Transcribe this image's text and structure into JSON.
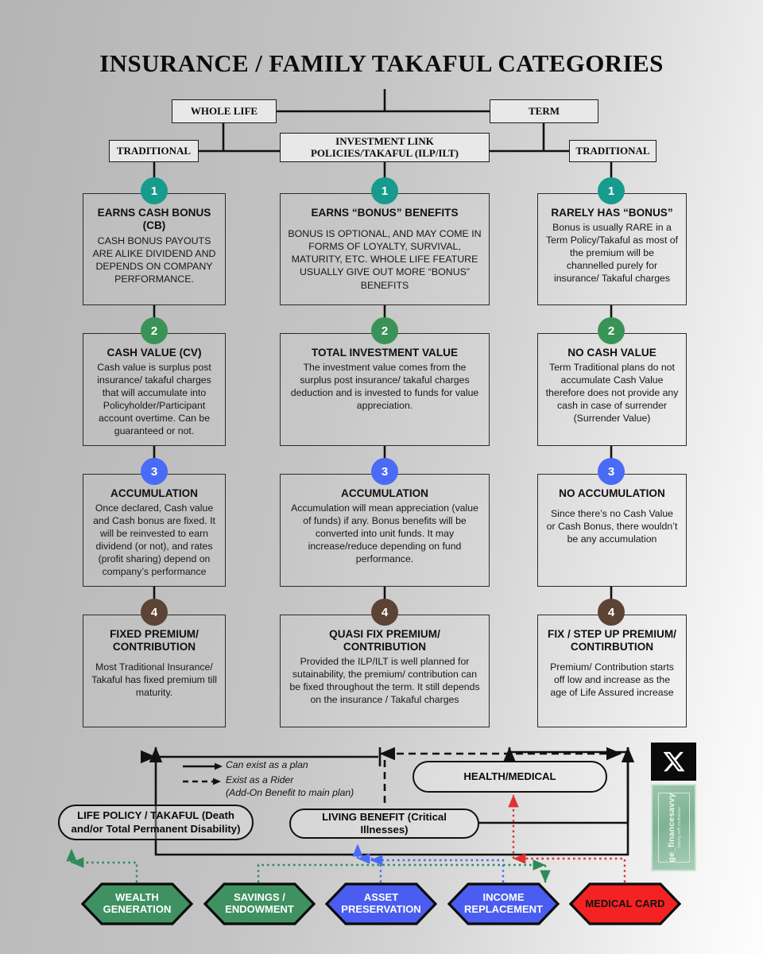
{
  "title": "INSURANCE  /  FAMILY TAKAFUL CATEGORIES",
  "top_nodes": {
    "whole_life": "WHOLE LIFE",
    "term": "TERM",
    "traditional_left": "TRADITIONAL",
    "traditional_right": "TRADITIONAL",
    "ilp": "INVESTMENT LINK\nPOLICIES/TAKAFUL (ILP/ILT)"
  },
  "columns": [
    {
      "key": "whole-life-traditional",
      "cards": [
        {
          "num": "1",
          "color": "#169b8c",
          "heading": "EARNS CASH BONUS (CB)",
          "body": "CASH BONUS PAYOUTS ARE ALIKE DIVIDEND AND DEPENDS ON COMPANY PERFORMANCE.",
          "spaced": false
        },
        {
          "num": "2",
          "color": "#3a9356",
          "heading": "CASH VALUE (CV)",
          "body": "Cash value is surplus post insurance/ takaful charges that will accumulate into Policyholder/Participant account overtime. Can be guaranteed or not.",
          "spaced": false
        },
        {
          "num": "3",
          "color": "#4a6bf5",
          "heading": "ACCUMULATION",
          "body": "Once declared, Cash value and Cash bonus are fixed. It will be reinvested to earn dividend (or not), and rates (profit sharing) depend on company’s performance",
          "spaced": false
        },
        {
          "num": "4",
          "color": "#5d4335",
          "heading": "FIXED PREMIUM/ CONTRIBUTION",
          "body": "Most Traditional Insurance/ Takaful has fixed premium till maturity.",
          "spaced": true
        }
      ]
    },
    {
      "key": "investment-link",
      "cards": [
        {
          "num": "1",
          "color": "#169b8c",
          "heading": "EARNS “BONUS” BENEFITS",
          "body": "BONUS IS OPTIONAL, AND MAY COME IN FORMS OF LOYALTY, SURVIVAL, MATURITY, ETC. WHOLE LIFE FEATURE USUALLY GIVE OUT MORE “BONUS” BENEFITS",
          "spaced": true
        },
        {
          "num": "2",
          "color": "#3a9356",
          "heading": "TOTAL INVESTMENT VALUE",
          "body": "The investment value comes from the surplus post insurance/ takaful charges deduction and is invested to funds for value appreciation.",
          "spaced": false
        },
        {
          "num": "3",
          "color": "#4a6bf5",
          "heading": "ACCUMULATION",
          "body": "Accumulation will mean appreciation (value of funds) if any. Bonus benefits will be converted into unit funds. It may increase/reduce depending on fund performance.",
          "spaced": false
        },
        {
          "num": "4",
          "color": "#5d4335",
          "heading": "QUASI FIX PREMIUM/ CONTRIBUTION",
          "body": "Provided the ILP/ILT is well planned for sutainability, the premium/ contribution can be fixed throughout the term. It still depends on the insurance / Takaful charges",
          "spaced": false
        }
      ]
    },
    {
      "key": "term-traditional",
      "cards": [
        {
          "num": "1",
          "color": "#169b8c",
          "heading": "RARELY HAS “BONUS”",
          "body": "Bonus is usually RARE in a Term Policy/Takaful as most of the premium will be channelled purely for insurance/ Takaful charges",
          "spaced": false
        },
        {
          "num": "2",
          "color": "#3a9356",
          "heading": "NO CASH VALUE",
          "body": "Term Traditional plans do not accumulate Cash Value therefore does not provide any cash in case of surrender (Surrender Value)",
          "spaced": false
        },
        {
          "num": "3",
          "color": "#4a6bf5",
          "heading": "NO ACCUMULATION",
          "body": "Since there’s no Cash Value or Cash Bonus, there wouldn’t be any accumulation",
          "spaced": true
        },
        {
          "num": "4",
          "color": "#5d4335",
          "heading": "FIX / STEP UP PREMIUM/ CONTIRBUTION",
          "body": "Premium/ Contribution starts off low and increase as the age of Life Assured increase",
          "spaced": true
        }
      ]
    }
  ],
  "legend": {
    "solid_label": "Can exist as a plan",
    "dashed_label_1": "Exist as a Rider",
    "dashed_label_2": "(Add-On Benefit to main plan)"
  },
  "benefits": {
    "life_policy": "LIFE POLICY / TAKAFUL (Death and/or Total Permanent Disability)",
    "living_benefit": "LIVING BENEFIT (Critical Illnesses)",
    "health_medical": "HEALTH/MEDICAL"
  },
  "outcomes": [
    {
      "label": "WEALTH GENERATION",
      "fill": "#3f9162",
      "text": "#ffffff"
    },
    {
      "label": "SAVINGS / ENDOWMENT",
      "fill": "#3f9162",
      "text": "#ffffff"
    },
    {
      "label": "ASSET PRESERVATION",
      "fill": "#4a5df0",
      "text": "#ffffff"
    },
    {
      "label": "INCOME REPLACEMENT",
      "fill": "#4a5df0",
      "text": "#ffffff"
    },
    {
      "label": "MEDICAL CARD",
      "fill": "#f42222",
      "text": "#111111"
    }
  ],
  "watermark": {
    "handle": "ge_financesavvy",
    "tagline": "helping with confidence",
    "platform_icon": "x-logo-icon"
  }
}
